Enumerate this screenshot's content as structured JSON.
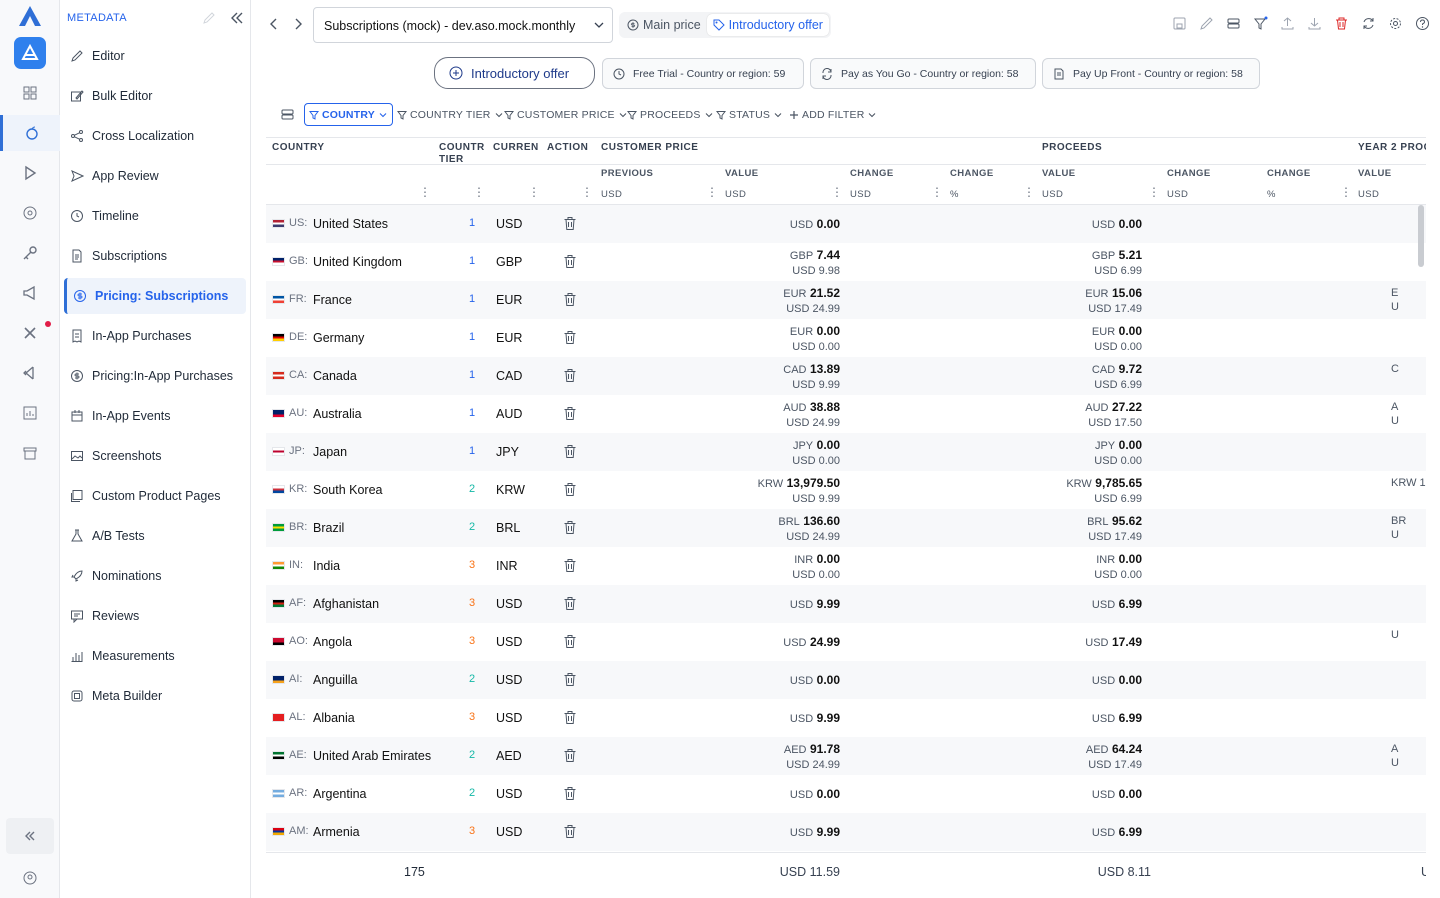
{
  "sidebar": {
    "header": "METADATA",
    "items": [
      {
        "label": "Editor",
        "icon": "pencil-icon"
      },
      {
        "label": "Bulk Editor",
        "icon": "bulk-edit-icon"
      },
      {
        "label": "Cross Localization",
        "icon": "share-icon"
      },
      {
        "label": "App Review",
        "icon": "send-icon"
      },
      {
        "label": "Timeline",
        "icon": "history-icon"
      },
      {
        "label": "Subscriptions",
        "icon": "document-icon"
      },
      {
        "label": "Pricing: Subscriptions",
        "icon": "dollar-icon",
        "active": true
      },
      {
        "label": "In-App Purchases",
        "icon": "receipt-icon"
      },
      {
        "label": "Pricing:In-App Purchases",
        "icon": "dollar-icon"
      },
      {
        "label": "In-App Events",
        "icon": "calendar-icon"
      },
      {
        "label": "Screenshots",
        "icon": "image-icon"
      },
      {
        "label": "Custom Product Pages",
        "icon": "pages-icon"
      },
      {
        "label": "A/B Tests",
        "icon": "flask-icon"
      },
      {
        "label": "Nominations",
        "icon": "rocket-icon"
      },
      {
        "label": "Reviews",
        "icon": "review-icon"
      },
      {
        "label": "Measurements",
        "icon": "chart-icon"
      },
      {
        "label": "Meta Builder",
        "icon": "builder-icon"
      }
    ]
  },
  "topbar": {
    "app_selector": "Subscriptions (mock) - dev.aso.mock.monthly",
    "tabs": [
      {
        "label": "Main price",
        "icon": "dollar-icon",
        "active": false
      },
      {
        "label": "Introductory offer",
        "icon": "tag-icon",
        "active": true
      }
    ]
  },
  "offers": {
    "main": "Introductory offer",
    "items": [
      {
        "label": "Free Trial - Country or region: 59",
        "icon": "clock-icon"
      },
      {
        "label": "Pay as You Go - Country or region: 58",
        "icon": "refresh-icon"
      },
      {
        "label": "Pay Up Front - Country or region: 58",
        "icon": "document-icon"
      }
    ]
  },
  "filters": [
    {
      "label": "COUNTRY",
      "active": true
    },
    {
      "label": "COUNTRY TIER"
    },
    {
      "label": "CUSTOMER PRICE"
    },
    {
      "label": "PROCEEDS"
    },
    {
      "label": "STATUS"
    },
    {
      "label": "ADD FILTER"
    }
  ],
  "table": {
    "headers": {
      "country": "COUNTRY",
      "tier_line1": "COUNTR",
      "tier_line2": "TIER",
      "currency": "CURREN",
      "action": "ACTION",
      "customer_price": "CUSTOMER PRICE",
      "proceeds": "PROCEEDS",
      "year2": "YEAR 2 PROC"
    },
    "subheaders": {
      "previous": "PREVIOUS",
      "value": "VALUE",
      "change": "CHANGE",
      "change2": "CHANGE",
      "p_value": "VALUE",
      "p_change": "CHANGE",
      "p_change2": "CHANGE",
      "y2_value": "VALUE"
    },
    "units": {
      "previous": "USD",
      "value": "USD",
      "change": "USD",
      "change_pct": "%",
      "p_value": "USD",
      "p_change": "USD",
      "p_change_pct": "%",
      "y2_value": "USD"
    },
    "rows": [
      {
        "code": "US:",
        "name": "United States",
        "tier": "1",
        "cur": "USD",
        "price_cur": "USD",
        "price": "0.00",
        "price_usd": "",
        "proc_cur": "USD",
        "proc": "0.00",
        "proc_usd": "",
        "y2a": "",
        "y2b": "",
        "flag": [
          "#b22234",
          "#fff",
          "#3c3b6e"
        ]
      },
      {
        "code": "GB:",
        "name": "United Kingdom",
        "tier": "1",
        "cur": "GBP",
        "price_cur": "GBP",
        "price": "7.44",
        "price_usd": "USD 9.98",
        "proc_cur": "GBP",
        "proc": "5.21",
        "proc_usd": "USD 6.99",
        "y2a": "",
        "y2b": "",
        "flag": [
          "#012169",
          "#c8102e",
          "#fff"
        ]
      },
      {
        "code": "FR:",
        "name": "France",
        "tier": "1",
        "cur": "EUR",
        "price_cur": "EUR",
        "price": "21.52",
        "price_usd": "USD 24.99",
        "proc_cur": "EUR",
        "proc": "15.06",
        "proc_usd": "USD 17.49",
        "y2a": "E",
        "y2b": "U",
        "flag": [
          "#0055a4",
          "#fff",
          "#ef4135"
        ]
      },
      {
        "code": "DE:",
        "name": "Germany",
        "tier": "1",
        "cur": "EUR",
        "price_cur": "EUR",
        "price": "0.00",
        "price_usd": "USD 0.00",
        "proc_cur": "EUR",
        "proc": "0.00",
        "proc_usd": "USD 0.00",
        "y2a": "",
        "y2b": "",
        "flag": [
          "#000",
          "#dd0000",
          "#ffce00"
        ]
      },
      {
        "code": "CA:",
        "name": "Canada",
        "tier": "1",
        "cur": "CAD",
        "price_cur": "CAD",
        "price": "13.89",
        "price_usd": "USD 9.99",
        "proc_cur": "CAD",
        "proc": "9.72",
        "proc_usd": "USD 6.99",
        "y2a": "C",
        "y2b": "",
        "flag": [
          "#d52b1e",
          "#fff",
          "#d52b1e"
        ]
      },
      {
        "code": "AU:",
        "name": "Australia",
        "tier": "1",
        "cur": "AUD",
        "price_cur": "AUD",
        "price": "38.88",
        "price_usd": "USD 24.99",
        "proc_cur": "AUD",
        "proc": "27.22",
        "proc_usd": "USD 17.50",
        "y2a": "A",
        "y2b": "U",
        "flag": [
          "#012169",
          "#012169",
          "#e4002b"
        ]
      },
      {
        "code": "JP:",
        "name": "Japan",
        "tier": "1",
        "cur": "JPY",
        "price_cur": "JPY",
        "price": "0.00",
        "price_usd": "USD 0.00",
        "proc_cur": "JPY",
        "proc": "0.00",
        "proc_usd": "USD 0.00",
        "y2a": "",
        "y2b": "",
        "flag": [
          "#fff",
          "#bc002d",
          "#fff"
        ]
      },
      {
        "code": "KR:",
        "name": "South Korea",
        "tier": "2",
        "cur": "KRW",
        "price_cur": "KRW",
        "price": "13,979.50",
        "price_usd": "USD 9.99",
        "proc_cur": "KRW",
        "proc": "9,785.65",
        "proc_usd": "USD 6.99",
        "y2a": "KRW 1",
        "y2b": "",
        "flag": [
          "#fff",
          "#cd2e3a",
          "#0047a0"
        ]
      },
      {
        "code": "BR:",
        "name": "Brazil",
        "tier": "2",
        "cur": "BRL",
        "price_cur": "BRL",
        "price": "136.60",
        "price_usd": "USD 24.99",
        "proc_cur": "BRL",
        "proc": "95.62",
        "proc_usd": "USD 17.49",
        "y2a": "BR",
        "y2b": "U",
        "flag": [
          "#009c3b",
          "#ffdf00",
          "#009c3b"
        ]
      },
      {
        "code": "IN:",
        "name": "India",
        "tier": "3",
        "cur": "INR",
        "price_cur": "INR",
        "price": "0.00",
        "price_usd": "USD 0.00",
        "proc_cur": "INR",
        "proc": "0.00",
        "proc_usd": "USD 0.00",
        "y2a": "",
        "y2b": "",
        "flag": [
          "#ff9933",
          "#fff",
          "#138808"
        ]
      },
      {
        "code": "AF:",
        "name": "Afghanistan",
        "tier": "3",
        "cur": "USD",
        "price_cur": "USD",
        "price": "9.99",
        "price_usd": "",
        "proc_cur": "USD",
        "proc": "6.99",
        "proc_usd": "",
        "y2a": "",
        "y2b": "",
        "flag": [
          "#000",
          "#d32011",
          "#007a36"
        ]
      },
      {
        "code": "AO:",
        "name": "Angola",
        "tier": "3",
        "cur": "USD",
        "price_cur": "USD",
        "price": "24.99",
        "price_usd": "",
        "proc_cur": "USD",
        "proc": "17.49",
        "proc_usd": "",
        "y2a": "U",
        "y2b": "",
        "flag": [
          "#cc092f",
          "#cc092f",
          "#000"
        ]
      },
      {
        "code": "AI:",
        "name": "Anguilla",
        "tier": "2",
        "cur": "USD",
        "price_cur": "USD",
        "price": "0.00",
        "price_usd": "",
        "proc_cur": "USD",
        "proc": "0.00",
        "proc_usd": "",
        "y2a": "",
        "y2b": "",
        "flag": [
          "#012169",
          "#012169",
          "#f7a21b"
        ]
      },
      {
        "code": "AL:",
        "name": "Albania",
        "tier": "3",
        "cur": "USD",
        "price_cur": "USD",
        "price": "9.99",
        "price_usd": "",
        "proc_cur": "USD",
        "proc": "6.99",
        "proc_usd": "",
        "y2a": "",
        "y2b": "",
        "flag": [
          "#e41e20",
          "#e41e20",
          "#e41e20"
        ]
      },
      {
        "code": "AE:",
        "name": "United Arab Emirates",
        "tier": "2",
        "cur": "AED",
        "price_cur": "AED",
        "price": "91.78",
        "price_usd": "USD 24.99",
        "proc_cur": "AED",
        "proc": "64.24",
        "proc_usd": "USD 17.49",
        "y2a": "A",
        "y2b": "U",
        "flag": [
          "#00732f",
          "#fff",
          "#000"
        ]
      },
      {
        "code": "AR:",
        "name": "Argentina",
        "tier": "2",
        "cur": "USD",
        "price_cur": "USD",
        "price": "0.00",
        "price_usd": "",
        "proc_cur": "USD",
        "proc": "0.00",
        "proc_usd": "",
        "y2a": "",
        "y2b": "",
        "flag": [
          "#74acdf",
          "#fff",
          "#74acdf"
        ]
      },
      {
        "code": "AM:",
        "name": "Armenia",
        "tier": "3",
        "cur": "USD",
        "price_cur": "USD",
        "price": "9.99",
        "price_usd": "",
        "proc_cur": "USD",
        "proc": "6.99",
        "proc_usd": "",
        "y2a": "",
        "y2b": "",
        "flag": [
          "#d90012",
          "#0033a0",
          "#f2a800"
        ]
      }
    ],
    "footer": {
      "count": "175",
      "price": "USD 11.59",
      "proceeds": "USD 8.11",
      "y2": "U"
    }
  },
  "colors": {
    "accent": "#2563eb",
    "tier1": "#2563eb",
    "tier2": "#14b8a6",
    "tier3": "#f97316",
    "delete": "#dc2626"
  }
}
